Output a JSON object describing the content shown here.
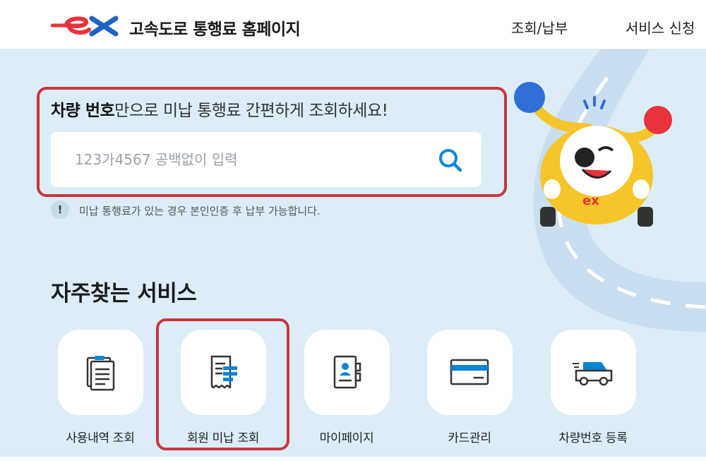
{
  "header": {
    "logo_text": "ex",
    "site_title": "고속도로 통행료 홈페이지",
    "nav": [
      "조회/납부",
      "서비스 신청"
    ]
  },
  "search": {
    "heading_bold": "차량 번호",
    "heading_rest": "만으로 미납 통행료 간편하게 조회하세요!",
    "placeholder": "123가4567 공백없이 입력",
    "value": ""
  },
  "notice": {
    "icon": "!",
    "text": "미납 통행료가 있는 경우 본인인증 후 납부 가능합니다."
  },
  "services": {
    "title": "자주찾는 서비스",
    "items": [
      {
        "label": "사용내역 조회",
        "icon": "document-list-icon"
      },
      {
        "label": "회원 미납 조회",
        "icon": "receipt-icon"
      },
      {
        "label": "마이페이지",
        "icon": "profile-card-icon"
      },
      {
        "label": "카드관리",
        "icon": "credit-card-icon"
      },
      {
        "label": "차량번호 등록",
        "icon": "van-icon"
      }
    ]
  },
  "colors": {
    "accent_blue": "#0a84d6",
    "brand_red": "#e8323c",
    "highlight_red": "#c9363e",
    "background": "#dcedf8"
  }
}
